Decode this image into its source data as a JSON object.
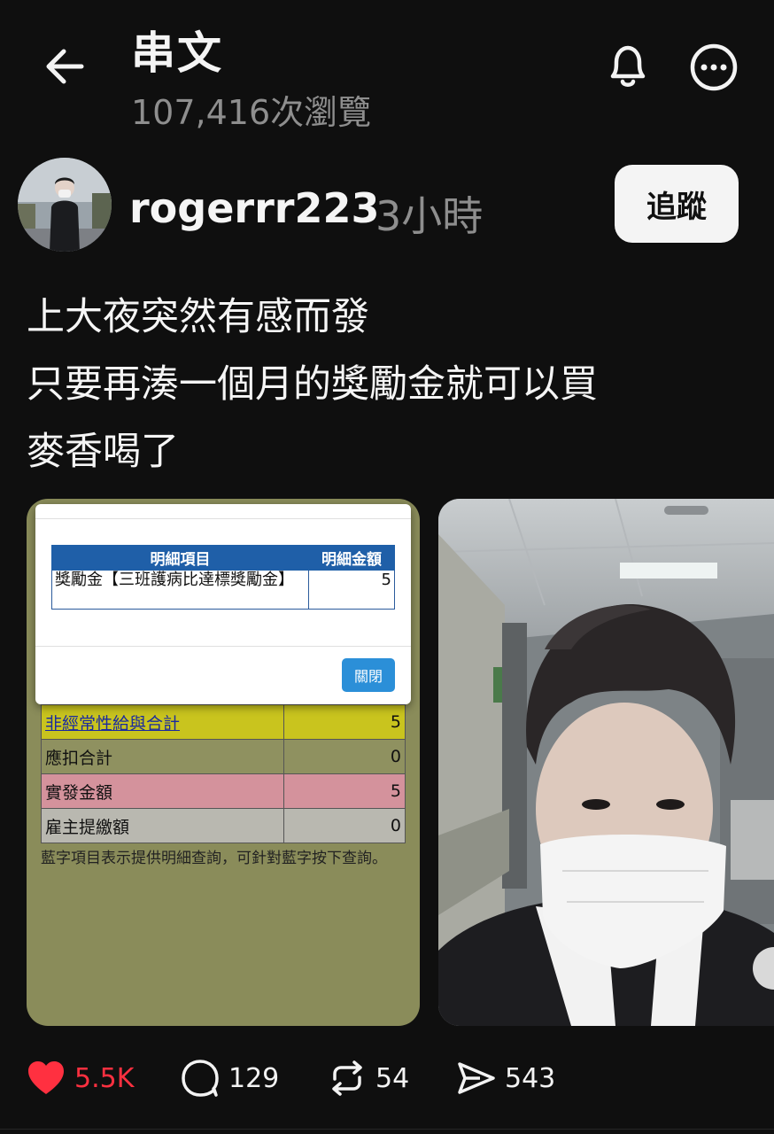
{
  "header": {
    "title": "串文",
    "views": "107,416次瀏覽"
  },
  "post": {
    "username": "rogerrr223",
    "time": "3小時",
    "follow_label": "追蹤",
    "lines": [
      "上大夜突然有感而發",
      "只要再湊一個月的獎勵金就可以買",
      "麥香喝了"
    ]
  },
  "slip": {
    "modal": {
      "col_item": "明細項目",
      "col_amount": "明細金額",
      "item": "獎勵金【三班護病比達標獎勵金】",
      "amount": "5",
      "close_label": "關閉"
    },
    "rows": [
      {
        "label": "非經常性給與合計",
        "value": "5"
      },
      {
        "label": "應扣合計",
        "value": "0"
      },
      {
        "label": "實發金額",
        "value": "5"
      },
      {
        "label": "雇主提繳額",
        "value": "0"
      }
    ],
    "note": "藍字項目表示提供明細查詢，可針對藍字按下查詢。"
  },
  "actions": {
    "likes": "5.5K",
    "comments": "129",
    "reposts": "54",
    "shares": "543"
  },
  "colors": {
    "background": "#0f0f0f",
    "like": "#ff3040",
    "muted": "#8e8e8e",
    "accent_blue": "#1f5fa8"
  },
  "icons": [
    "back-arrow-icon",
    "bell-icon",
    "more-icon",
    "heart-icon",
    "comment-icon",
    "repost-icon",
    "share-icon",
    "mute-icon"
  ]
}
